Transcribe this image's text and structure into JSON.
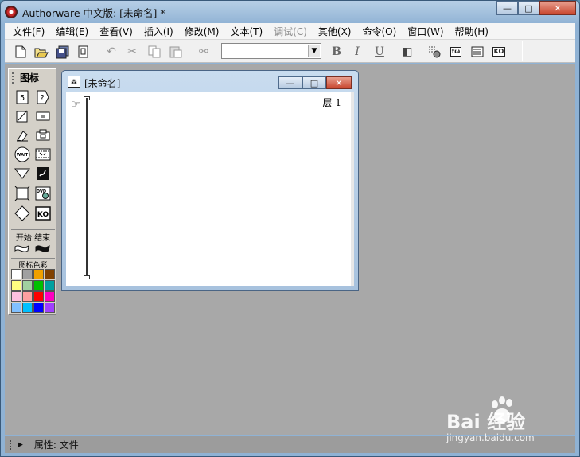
{
  "app": {
    "title": "Authorware 中文版: [未命名] *"
  },
  "window_buttons": {
    "minimize": "—",
    "maximize": "□",
    "close": "✕"
  },
  "menu": [
    {
      "label": "文件(F)",
      "disabled": false
    },
    {
      "label": "编辑(E)",
      "disabled": false
    },
    {
      "label": "查看(V)",
      "disabled": false
    },
    {
      "label": "插入(I)",
      "disabled": false
    },
    {
      "label": "修改(M)",
      "disabled": false
    },
    {
      "label": "文本(T)",
      "disabled": false
    },
    {
      "label": "调试(C)",
      "disabled": true
    },
    {
      "label": "其他(X)",
      "disabled": false
    },
    {
      "label": "命令(O)",
      "disabled": false
    },
    {
      "label": "窗口(W)",
      "disabled": false
    },
    {
      "label": "帮助(H)",
      "disabled": false
    }
  ],
  "toolbar": {
    "icons": [
      "new-icon",
      "open-icon",
      "save-all-icon",
      "import-icon",
      "undo-icon",
      "cut-icon",
      "copy-icon",
      "paste-icon",
      "find-icon"
    ],
    "font_select_value": "",
    "bold": "B",
    "italic": "I",
    "underline": "U",
    "run_icon": "restart-icon",
    "control_panel_icon": "control-panel-icon",
    "function_box": "fω",
    "variables_icon": "variables-icon",
    "knowledge_box": "KO"
  },
  "palette": {
    "title": "图标",
    "wait_label": "WAIT",
    "dvd_label": "DVD",
    "ko_label": "KO",
    "start_end_label": "开始 结束",
    "color_label": "图标色彩",
    "swatches": [
      "#ffffff",
      "#a0a0a0",
      "#f0a000",
      "#804000",
      "#ffff80",
      "#a0d0a0",
      "#00c000",
      "#00a0a0",
      "#ffc0e0",
      "#ffa0a0",
      "#ff0000",
      "#ff00c0",
      "#80c0ff",
      "#00c0ff",
      "#0000ff",
      "#a040ff"
    ]
  },
  "document": {
    "title": "[未命名]",
    "layer_label": "层 1"
  },
  "statusbar": {
    "text": "属性: 文件"
  },
  "watermark": {
    "logo": "Bai  经验",
    "url": "jingyan.baidu.com"
  }
}
